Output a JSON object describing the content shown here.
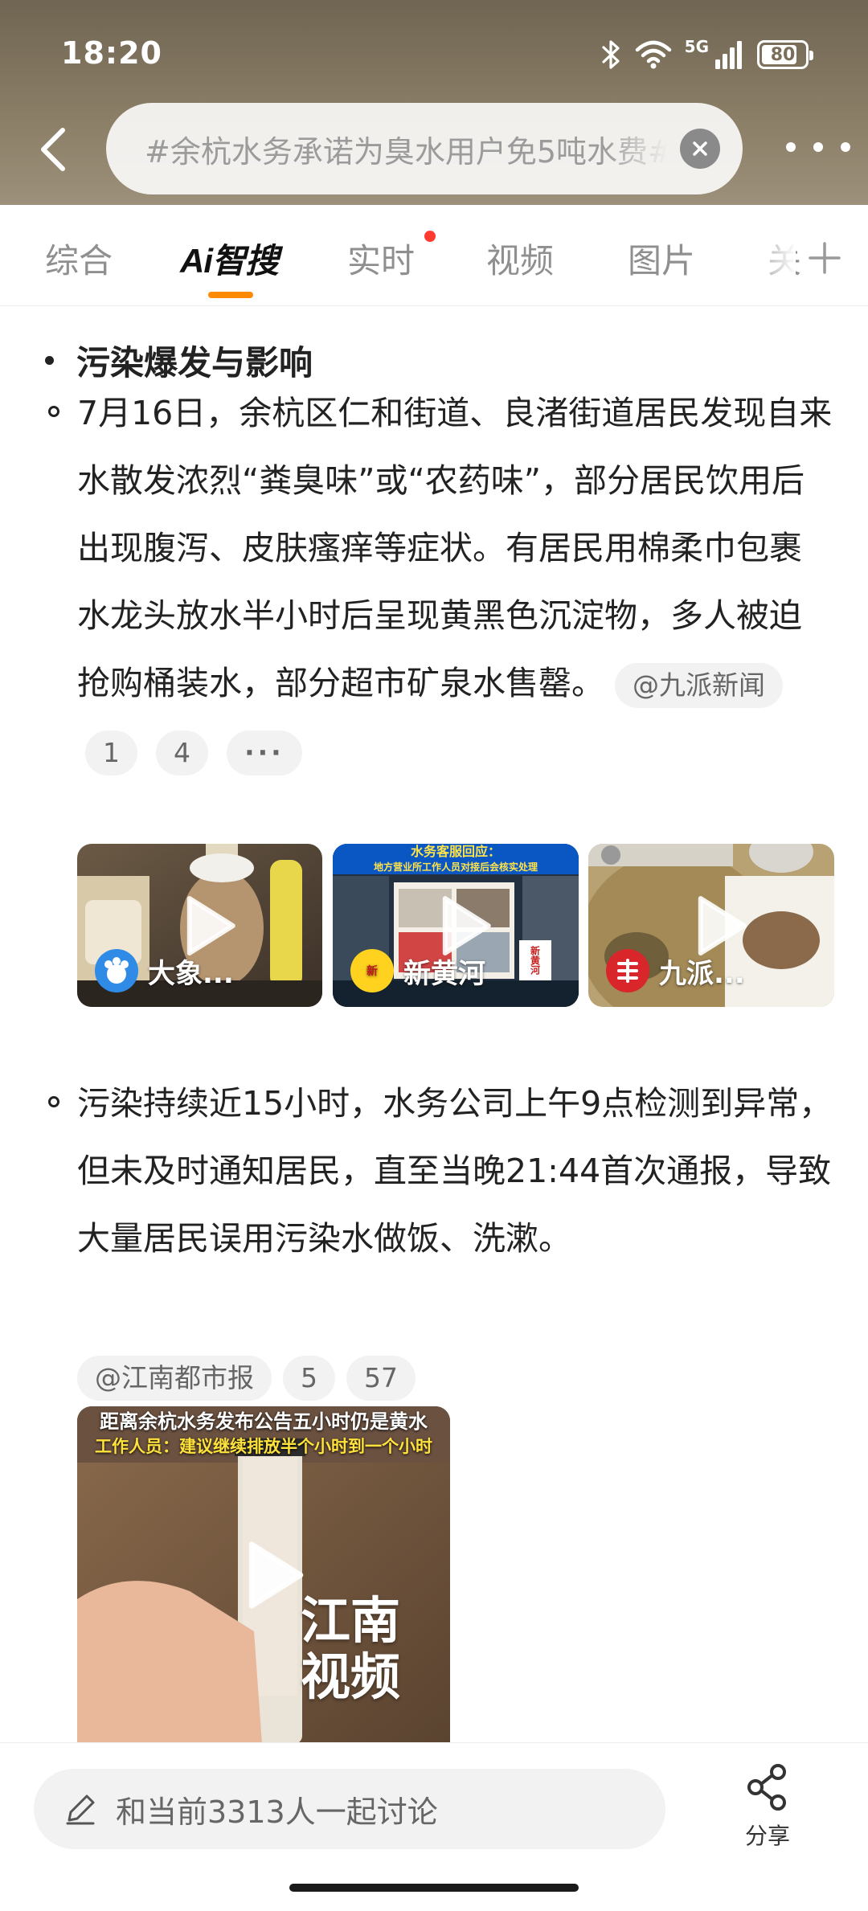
{
  "status_bar": {
    "time": "18:20",
    "network": "5G",
    "battery": "80",
    "icons": [
      "bluetooth-icon",
      "wifi-icon",
      "signal-icon",
      "battery-icon"
    ]
  },
  "search": {
    "query": "#余杭水务承诺为臭水用户免5吨水费#"
  },
  "tabs": [
    {
      "label": "综合"
    },
    {
      "label": "Ai智搜",
      "active": true
    },
    {
      "label": "实时",
      "has_dot": true
    },
    {
      "label": "视频"
    },
    {
      "label": "图片"
    },
    {
      "label": "关"
    }
  ],
  "content": {
    "heading": "污染爆发与影响",
    "item1": {
      "text": "7月16日，余杭区仁和街道、良渚街道居民发现自来水散发浓烈“粪臭味”或“农药味”，部分居民饮用后出现腹泻、皮肤瘙痒等症状。有居民用棉柔巾包裹水龙头放水半小时后呈现黄黑色沉淀物，多人被迫抢购桶装水，部分超市矿泉水售罄。",
      "source": "@九派新闻",
      "ref1": "1",
      "ref2": "4",
      "more": "···"
    },
    "videos1": [
      {
        "source": "大象...",
        "logo": "dx-logo"
      },
      {
        "source": "新黄河",
        "logo": "xhh-logo",
        "banner_title": "水务客服回应：",
        "banner_sub": "地方营业所工作人员对接后会核实处理",
        "stamp": "新黄河"
      },
      {
        "source": "九派...",
        "logo": "jp-logo"
      }
    ],
    "item2": {
      "text": "污染持续近15小时，水务公司上午9点检测到异常，但未及时通知居民，直至当晚21:44首次通报，导致大量居民误用污染水做饭、洗漱。",
      "source": "@江南都市报",
      "ref1": "5",
      "ref2": "57"
    },
    "video2": {
      "caption1": "距离余杭水务发布公告五小时仍是黄水",
      "caption2": "工作人员：建议继续排放半个小时到一个小时",
      "overlay": "江南\n视频",
      "overlay_line1": "江南",
      "overlay_line2": "视频"
    }
  },
  "bottom": {
    "discuss_placeholder": "和当前3313人一起讨论",
    "share_label": "分享"
  },
  "colors": {
    "header_bg": "#7d715c",
    "tab_indicator": "#ff8a00",
    "red_dot": "#ff3b30",
    "pill_bg": "#f2f2f2"
  }
}
